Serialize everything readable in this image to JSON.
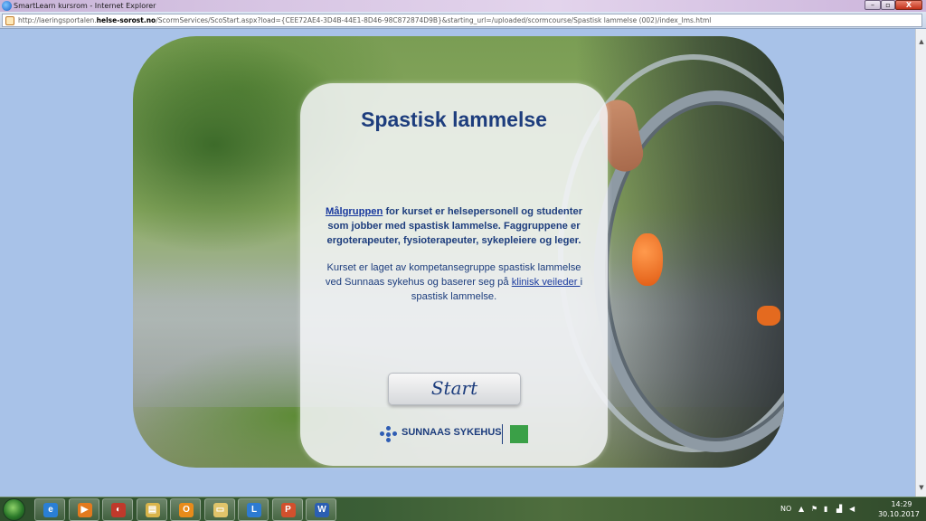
{
  "window": {
    "title": "SmartLearn kursrom - Internet Explorer",
    "minimize_label": "–",
    "maximize_label": "▫",
    "close_label": "X"
  },
  "address_bar": {
    "prefix": "http://laeringsportalen.",
    "host": "helse-sorost.no",
    "path": "/ScormServices/ScoStart.aspx?load={CEE72AE4-3D4B-44E1-8D46-98C872874D9B}&starting_url=/uploaded/scormcourse/Spastisk lammelse (002)/index_lms.html"
  },
  "course": {
    "title": "Spastisk lammelse",
    "p1_link": "Målgruppen",
    "p1_text": " for kurset er helsepersonell og studenter som jobber med spastisk lammelse. Faggruppene er ergoterapeuter, fysioterapeuter, sykepleiere og leger.",
    "p2_text_before": "Kurset er laget av kompetansegruppe spastisk lammelse ved Sunnaas sykehus og baserer seg på ",
    "p2_link": "klinisk veileder ",
    "p2_text_after": "i spastisk lammelse.",
    "start_label": "Start",
    "logo_name": "SUNNAAS SYKEHUS"
  },
  "taskbar": {
    "apps": [
      {
        "icon": "internet-explorer-icon",
        "glyph": "e",
        "color": "#2a7fd6"
      },
      {
        "icon": "media-player-icon",
        "glyph": "▶",
        "color": "#e37a1e"
      },
      {
        "icon": "browser-icon",
        "glyph": "◐",
        "color": "#c0392b"
      },
      {
        "icon": "file-explorer-icon",
        "glyph": "▤",
        "color": "#d9b44a"
      },
      {
        "icon": "outlook-icon",
        "glyph": "O",
        "color": "#e88b1a"
      },
      {
        "icon": "folder-icon",
        "glyph": "▭",
        "color": "#e0c46a"
      },
      {
        "icon": "lync-icon",
        "glyph": "L",
        "color": "#2d7bd1"
      },
      {
        "icon": "powerpoint-icon",
        "glyph": "P",
        "color": "#d2502d"
      },
      {
        "icon": "word-icon",
        "glyph": "W",
        "color": "#2b5fb3"
      }
    ],
    "tray": {
      "language": "NO",
      "time": "14:29",
      "date": "30.10.2017"
    }
  }
}
